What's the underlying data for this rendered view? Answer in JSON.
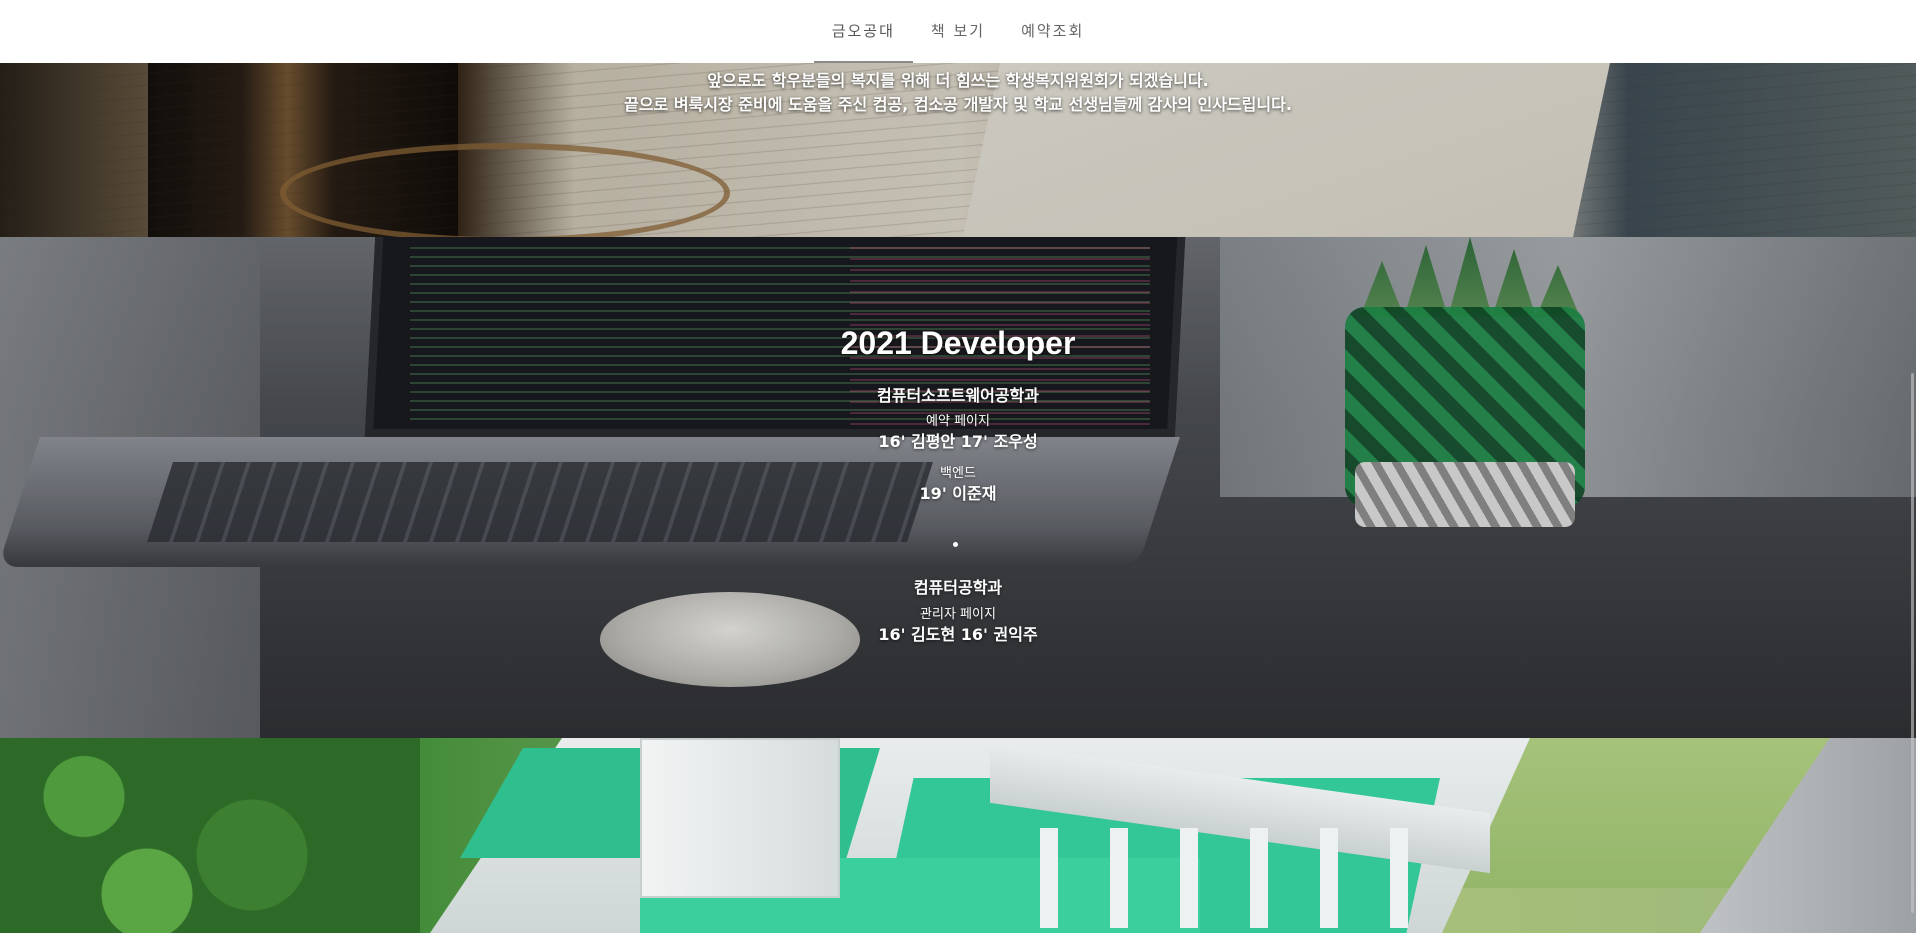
{
  "nav": {
    "items": [
      {
        "label": "금오공대",
        "active": true
      },
      {
        "label": "책 보기",
        "active": false
      },
      {
        "label": "예약조회",
        "active": false
      }
    ]
  },
  "thanks_section": {
    "lines": [
      "앞으로도 학우분들의 복지를 위해 더 힘쓰는 학생복지위원회가 되겠습니다.",
      "끝으로 벼룩시장 준비에 도움을 주신 컴공, 컴소공 개발자 및 학교 선생님들께 감사의 인사드립니다."
    ],
    "background_image": "open books with reading glasses, 'The Annotated Pride' book"
  },
  "developer_section": {
    "title": "2021 Developer",
    "groups": [
      {
        "department": "컴퓨터소프트웨어공학과",
        "roles": [
          {
            "role": "예약 페이지",
            "names": "16' 김평안 17' 조우성"
          },
          {
            "role": "백엔드",
            "names": "19' 이준재"
          }
        ]
      },
      {
        "department": "컴퓨터공학과",
        "roles": [
          {
            "role": "관리자 페이지",
            "names": "16' 김도현 16' 권익주"
          }
        ]
      }
    ],
    "background_image": "laptop with code on screen, mouse, and green plant"
  },
  "campus_section": {
    "background_image": "aerial view of campus building with green roofs"
  },
  "colors": {
    "nav_text": "#666666",
    "nav_active_underline": "#8a8a8a",
    "overlay_text": "#ffffff",
    "roof_green": "#33c696"
  }
}
